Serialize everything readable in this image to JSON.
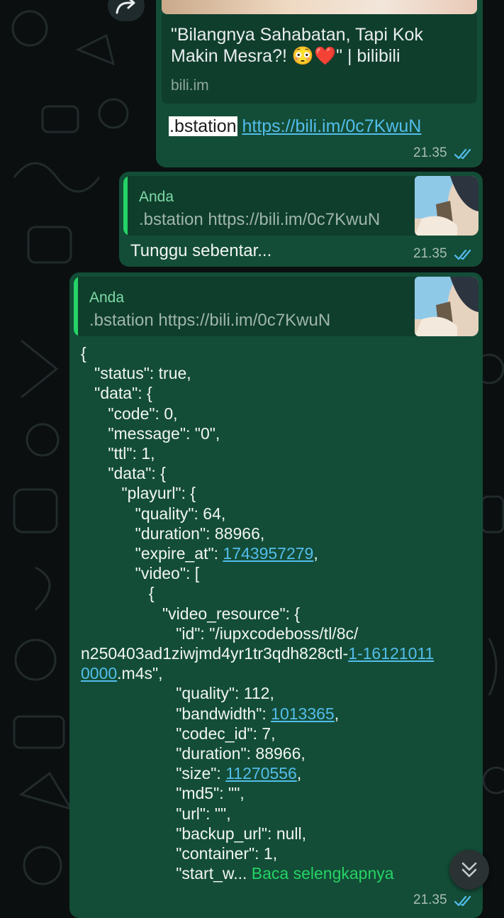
{
  "link_preview": {
    "title": "\"Bilangnya Sahabatan, Tapi Kok Makin Mesra?! 😳❤️\" | bilibili",
    "title_line1": "\"Bilangnya Sahabatan, Tapi Kok",
    "title_line2": "Makin Mesra?! 😳❤️\" | bilibili",
    "domain": "bili.im",
    "message_prefix": ".bstation",
    "message_link": "https://bili.im/0c7KwuN",
    "time": "21.35"
  },
  "reply1": {
    "quote_author": "Anda",
    "quote_text": ".bstation https://bili.im/0c7KwuN",
    "text": "Tunggu sebentar...",
    "time": "21.35"
  },
  "reply2": {
    "quote_author": "Anda",
    "quote_text": ".bstation https://bili.im/0c7KwuN",
    "time": "21.35",
    "read_more": "Baca selengkapnya",
    "code_lines": [
      {
        "t": "{"
      },
      {
        "t": "   \"status\": true,"
      },
      {
        "t": "   \"data\": {"
      },
      {
        "t": "      \"code\": 0,"
      },
      {
        "t": "      \"message\": \"0\","
      },
      {
        "t": "      \"ttl\": 1,"
      },
      {
        "t": "      \"data\": {"
      },
      {
        "t": "         \"playurl\": {"
      },
      {
        "t": "            \"quality\": 64,"
      },
      {
        "t": "            \"duration\": 88966,"
      },
      {
        "t": "            \"expire_at\": ",
        "link": "1743957279",
        "after": ","
      },
      {
        "t": "            \"video\": ["
      },
      {
        "t": "               {"
      },
      {
        "t": "                  \"video_resource\": {"
      },
      {
        "t": "                     \"id\": \"/iupxcodeboss/tl/8c/"
      },
      {
        "t": "n250403ad1ziwjmd4yr1tr3qdh828ctl-",
        "link": "1-16121011"
      },
      {
        "t": "",
        "link": "0000",
        "after": ".m4s\","
      },
      {
        "t": "                     \"quality\": 112,"
      },
      {
        "t": "                     \"bandwidth\": ",
        "link": "1013365",
        "after": ","
      },
      {
        "t": "                     \"codec_id\": 7,"
      },
      {
        "t": "                     \"duration\": 88966,"
      },
      {
        "t": "                     \"size\": ",
        "link": "11270556",
        "after": ","
      },
      {
        "t": "                     \"md5\": \"\","
      },
      {
        "t": "                     \"url\": \"\","
      },
      {
        "t": "                     \"backup_url\": null,"
      },
      {
        "t": "                     \"container\": 1,"
      },
      {
        "t": "                     \"start_w... ",
        "more": true
      }
    ]
  },
  "icons": {
    "forward": "forward-icon",
    "scroll_down": "double-chevron-down-icon",
    "read_ticks": "double-check-icon"
  },
  "colors": {
    "bubble": "#134d37",
    "quote": "#0f3e2c",
    "link": "#53bdeb",
    "accent": "#25d366"
  }
}
